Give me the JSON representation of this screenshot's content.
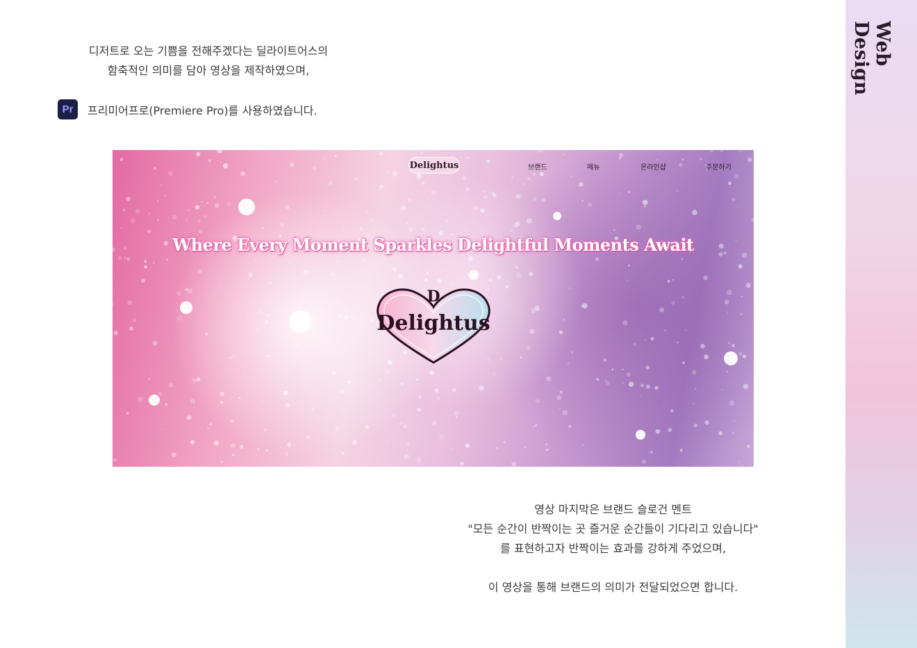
{
  "intro": {
    "line1": "디저트로 오는 기쁨을 전해주겠다는 딜라이트어스의",
    "line2": "함축적인 의미를 담아 영상을 제작하였으며,"
  },
  "tool": {
    "badge": "Pr",
    "text": "프리미어프로(Premiere Pro)를 사용하였습니다."
  },
  "hero": {
    "nav_logo": "Delightus",
    "nav_items": [
      "브랜드",
      "메뉴",
      "온라인샵",
      "주문하기"
    ],
    "headline": "Where Every Moment Sparkles  Delightful Moments Await",
    "logo_mark": "D",
    "logo_word": "Delightus",
    "colors": {
      "pink": "#e36aa2",
      "lavender": "#a47bc1",
      "glow": "#ee7cb6"
    }
  },
  "outro": {
    "line1": "영상 마지막은 브랜드 슬로건 멘트",
    "line2": "\"모든 순간이 반짝이는 곳 즐거운 순간들이 기다리고 있습니다\"",
    "line3": "를 표현하고자 반짝이는 효과를 강하게 주었으며,",
    "line4": "이 영상을 통해 브랜드의 의미가 전달되었으면 합니다."
  },
  "side": {
    "title": "Web Design"
  }
}
